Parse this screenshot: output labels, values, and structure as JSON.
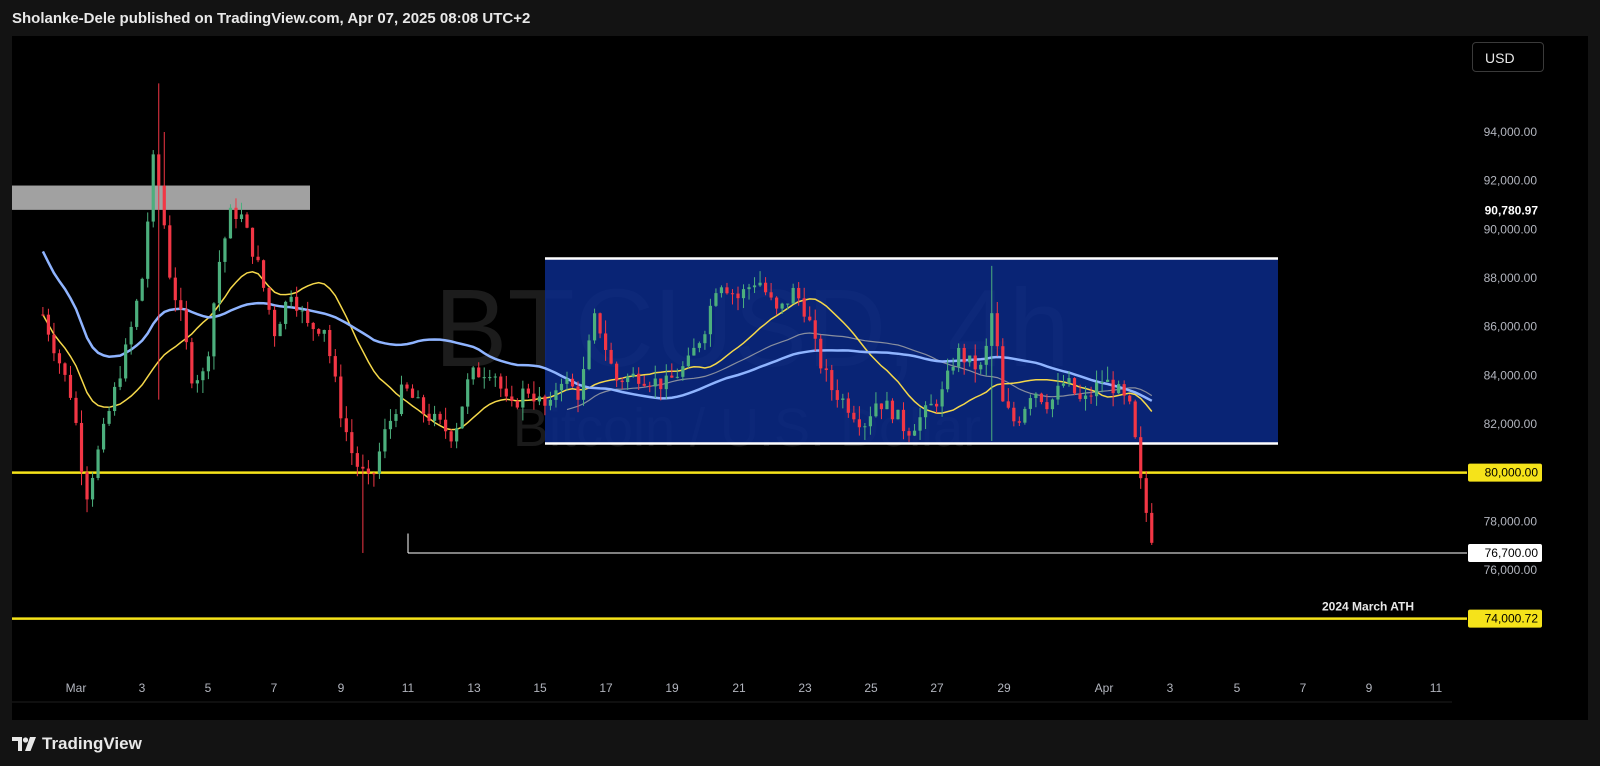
{
  "header": {
    "text": "Sholanke-Dele published on TradingView.com, Apr 07, 2025 08:08 UTC+2"
  },
  "footer": {
    "brand": "TradingView",
    "logo_icon": "tradingview-logo-icon"
  },
  "toolbar": {
    "currency": "USD"
  },
  "watermark": {
    "symbol": "BTCUSD, 4h",
    "description": "Bitcoin / U.S. Dollar"
  },
  "colors": {
    "up": "#4caf7d",
    "down": "#f23645",
    "ma_fast": "#f5d84a",
    "ma_slow": "#8fb4ff",
    "ma_mid": "#a9a9a9",
    "range_box": "#0b2a8a",
    "level": "#f5e31a",
    "supply_zone": "#bdbdbd"
  },
  "chart_data": {
    "type": "candlestick",
    "symbol": "BTCUSD",
    "timeframe": "4h",
    "ylim": [
      72000,
      96000
    ],
    "y_ticks": [
      94000,
      92000,
      90000,
      88000,
      86000,
      84000,
      82000,
      80000,
      78000,
      76000
    ],
    "y_tick_labels": [
      "94,000.00",
      "92,000.00",
      "90,000.00",
      "88,000.00",
      "86,000.00",
      "84,000.00",
      "82,000.00",
      "80,000.00",
      "78,000.00",
      "76,000.00"
    ],
    "x_ticks": [
      "Mar",
      "3",
      "5",
      "7",
      "9",
      "11",
      "13",
      "15",
      "17",
      "19",
      "21",
      "23",
      "25",
      "27",
      "29",
      "Apr",
      "3",
      "5",
      "7",
      "9",
      "11"
    ],
    "price_tags": [
      {
        "label": "90,780.97",
        "value": 90780.97,
        "style": "plain"
      },
      {
        "label": "80,000.00",
        "value": 80000,
        "style": "yellow"
      },
      {
        "label": "76,700.00",
        "value": 76700,
        "style": "white"
      },
      {
        "label": "74,000.72",
        "value": 74000.72,
        "style": "yellow"
      }
    ],
    "levels": [
      {
        "value": 80000,
        "color": "#f5e31a"
      },
      {
        "value": 74000.72,
        "color": "#f5e31a",
        "label": "2024 March ATH"
      }
    ],
    "support_line": {
      "value": 76700,
      "from": "Mar 11",
      "color": "#ffffff"
    },
    "range_box": {
      "from": "Mar 15",
      "to": "Apr 6",
      "high": 88800,
      "low": 81200
    },
    "supply_zone": {
      "from": "Feb 27",
      "to": "Mar 8",
      "high": 91800,
      "low": 90800
    },
    "anchors": [
      {
        "t": 0,
        "v": 86500
      },
      {
        "t": 0.9,
        "v": 83000
      },
      {
        "t": 1.3,
        "v": 79000
      },
      {
        "t": 1.6,
        "v": 80500
      },
      {
        "t": 2.6,
        "v": 85500
      },
      {
        "t": 3.0,
        "v": 88000
      },
      {
        "t": 3.35,
        "v": 93000
      },
      {
        "t": 3.6,
        "v": 91000
      },
      {
        "t": 3.85,
        "v": 88000
      },
      {
        "t": 4.15,
        "v": 86500
      },
      {
        "t": 4.5,
        "v": 84000
      },
      {
        "t": 4.9,
        "v": 84000
      },
      {
        "t": 5.3,
        "v": 88500
      },
      {
        "t": 5.7,
        "v": 90800
      },
      {
        "t": 6.0,
        "v": 90500
      },
      {
        "t": 6.5,
        "v": 88500
      },
      {
        "t": 7.0,
        "v": 85800
      },
      {
        "t": 7.5,
        "v": 87500
      },
      {
        "t": 8.0,
        "v": 86000
      },
      {
        "t": 8.5,
        "v": 86000
      },
      {
        "t": 9.0,
        "v": 82500
      },
      {
        "t": 9.4,
        "v": 80500
      },
      {
        "t": 9.9,
        "v": 79500
      },
      {
        "t": 10.3,
        "v": 81500
      },
      {
        "t": 10.9,
        "v": 83500
      },
      {
        "t": 11.5,
        "v": 82500
      },
      {
        "t": 12.4,
        "v": 81500
      },
      {
        "t": 12.9,
        "v": 84000
      },
      {
        "t": 13.6,
        "v": 84300
      },
      {
        "t": 14.1,
        "v": 82500
      },
      {
        "t": 14.6,
        "v": 83500
      },
      {
        "t": 15.3,
        "v": 82500
      },
      {
        "t": 15.6,
        "v": 84000
      },
      {
        "t": 16.2,
        "v": 83200
      },
      {
        "t": 16.7,
        "v": 86500
      },
      {
        "t": 17.3,
        "v": 83800
      },
      {
        "t": 18.0,
        "v": 84000
      },
      {
        "t": 18.8,
        "v": 83600
      },
      {
        "t": 19.5,
        "v": 84500
      },
      {
        "t": 20.0,
        "v": 86000
      },
      {
        "t": 20.4,
        "v": 88000
      },
      {
        "t": 21.0,
        "v": 87200
      },
      {
        "t": 21.6,
        "v": 88000
      },
      {
        "t": 22.2,
        "v": 86500
      },
      {
        "t": 22.7,
        "v": 87500
      },
      {
        "t": 23.1,
        "v": 86500
      },
      {
        "t": 23.4,
        "v": 84800
      },
      {
        "t": 23.8,
        "v": 83500
      },
      {
        "t": 24.3,
        "v": 82800
      },
      {
        "t": 24.8,
        "v": 82000
      },
      {
        "t": 25.2,
        "v": 83000
      },
      {
        "t": 25.7,
        "v": 82500
      },
      {
        "t": 26.1,
        "v": 81700
      },
      {
        "t": 26.7,
        "v": 82500
      },
      {
        "t": 27.2,
        "v": 83300
      },
      {
        "t": 27.6,
        "v": 85000
      },
      {
        "t": 28.0,
        "v": 84500
      },
      {
        "t": 28.4,
        "v": 84200
      },
      {
        "t": 28.7,
        "v": 86800
      },
      {
        "t": 29.0,
        "v": 82800
      },
      {
        "t": 29.4,
        "v": 82000
      },
      {
        "t": 29.9,
        "v": 83500
      },
      {
        "t": 30.4,
        "v": 82800
      },
      {
        "t": 30.9,
        "v": 83800
      },
      {
        "t": 31.4,
        "v": 82800
      },
      {
        "t": 32.0,
        "v": 83800
      },
      {
        "t": 32.4,
        "v": 83500
      },
      {
        "t": 32.9,
        "v": 82500
      },
      {
        "t": 33.1,
        "v": 80000
      },
      {
        "t": 33.4,
        "v": 77900
      },
      {
        "t": 33.6,
        "v": 76900
      }
    ],
    "spikes": [
      {
        "t": 3.55,
        "high": 96000,
        "low": 83000
      },
      {
        "t": 3.7,
        "high": 94000
      },
      {
        "t": 9.6,
        "low": 76700
      },
      {
        "t": 28.7,
        "high": 88500,
        "low": 81300
      }
    ],
    "x_range": [
      0,
      38
    ],
    "x_tick_positions": [
      1.5,
      3.5,
      5.5,
      7.5,
      9.5,
      11.5,
      13.5,
      15.5,
      17.5,
      19.5,
      21.5,
      23.5,
      25.5,
      27.5,
      29.5,
      31.5,
      32.5,
      34.5,
      36.5,
      38.5,
      40.5
    ],
    "t_scale_note": "t in days since Feb 28 00:00"
  }
}
